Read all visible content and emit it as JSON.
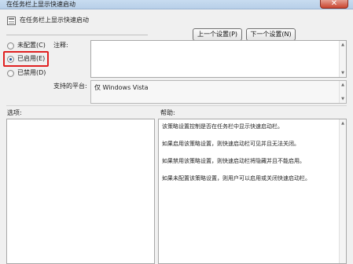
{
  "window": {
    "title": "在任务栏上显示快速启动",
    "close_glyph": "✕"
  },
  "header": {
    "setting_title": "在任务栏上显示快速启动",
    "prev_button": "上一个设置(P)",
    "next_button": "下一个设置(N)"
  },
  "state": {
    "options": [
      {
        "label": "未配置(C)",
        "checked": false
      },
      {
        "label": "已启用(E)",
        "checked": true
      },
      {
        "label": "已禁用(D)",
        "checked": false
      }
    ],
    "highlight_color": "#e02020"
  },
  "comment": {
    "label": "注释:",
    "value": ""
  },
  "supported": {
    "label": "支持的平台:",
    "value": "仅 Windows Vista"
  },
  "options_pane": {
    "label": "选项:"
  },
  "help_pane": {
    "label": "帮助:",
    "paragraphs": [
      "该策略设置控制是否在任务栏中显示快速启动栏。",
      "如果启用该策略设置，则快速启动栏可见并且无法关闭。",
      "如果禁用该策略设置，则快速启动栏将隐藏并且不能启用。",
      "如果未配置该策略设置，则用户可以启用或关闭快速启动栏。"
    ]
  }
}
